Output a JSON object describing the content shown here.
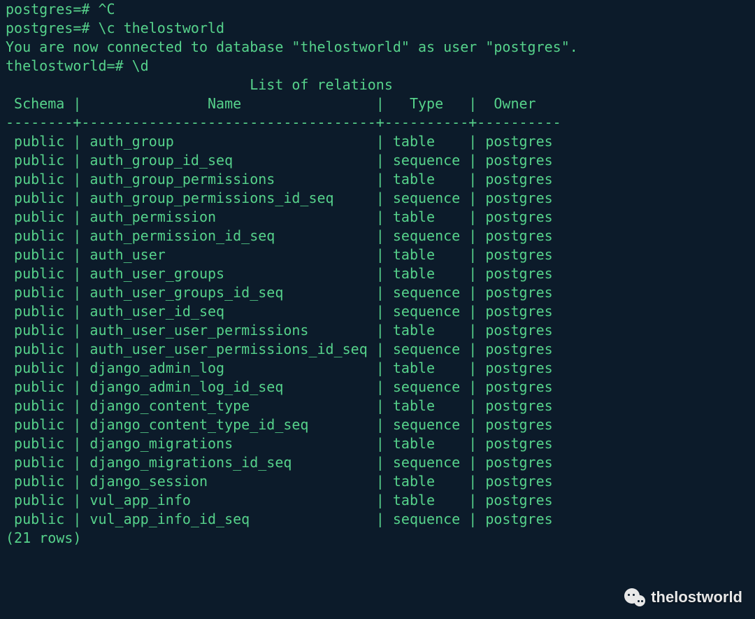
{
  "prompt0": "postgres=# ^C",
  "prompt1": "postgres=# \\c thelostworld",
  "connect_msg": "You are now connected to database \"thelostworld\" as user \"postgres\".",
  "prompt2": "thelostworld=# \\d",
  "title": "List of relations",
  "headers": {
    "schema": "Schema",
    "name": "Name",
    "type": "Type",
    "owner": "Owner"
  },
  "rows": [
    {
      "schema": "public",
      "name": "auth_group",
      "type": "table",
      "owner": "postgres"
    },
    {
      "schema": "public",
      "name": "auth_group_id_seq",
      "type": "sequence",
      "owner": "postgres"
    },
    {
      "schema": "public",
      "name": "auth_group_permissions",
      "type": "table",
      "owner": "postgres"
    },
    {
      "schema": "public",
      "name": "auth_group_permissions_id_seq",
      "type": "sequence",
      "owner": "postgres"
    },
    {
      "schema": "public",
      "name": "auth_permission",
      "type": "table",
      "owner": "postgres"
    },
    {
      "schema": "public",
      "name": "auth_permission_id_seq",
      "type": "sequence",
      "owner": "postgres"
    },
    {
      "schema": "public",
      "name": "auth_user",
      "type": "table",
      "owner": "postgres"
    },
    {
      "schema": "public",
      "name": "auth_user_groups",
      "type": "table",
      "owner": "postgres"
    },
    {
      "schema": "public",
      "name": "auth_user_groups_id_seq",
      "type": "sequence",
      "owner": "postgres"
    },
    {
      "schema": "public",
      "name": "auth_user_id_seq",
      "type": "sequence",
      "owner": "postgres"
    },
    {
      "schema": "public",
      "name": "auth_user_user_permissions",
      "type": "table",
      "owner": "postgres"
    },
    {
      "schema": "public",
      "name": "auth_user_user_permissions_id_seq",
      "type": "sequence",
      "owner": "postgres"
    },
    {
      "schema": "public",
      "name": "django_admin_log",
      "type": "table",
      "owner": "postgres"
    },
    {
      "schema": "public",
      "name": "django_admin_log_id_seq",
      "type": "sequence",
      "owner": "postgres"
    },
    {
      "schema": "public",
      "name": "django_content_type",
      "type": "table",
      "owner": "postgres"
    },
    {
      "schema": "public",
      "name": "django_content_type_id_seq",
      "type": "sequence",
      "owner": "postgres"
    },
    {
      "schema": "public",
      "name": "django_migrations",
      "type": "table",
      "owner": "postgres"
    },
    {
      "schema": "public",
      "name": "django_migrations_id_seq",
      "type": "sequence",
      "owner": "postgres"
    },
    {
      "schema": "public",
      "name": "django_session",
      "type": "table",
      "owner": "postgres"
    },
    {
      "schema": "public",
      "name": "vul_app_info",
      "type": "table",
      "owner": "postgres"
    },
    {
      "schema": "public",
      "name": "vul_app_info_id_seq",
      "type": "sequence",
      "owner": "postgres"
    }
  ],
  "row_count_label": "(21 rows)",
  "watermark": "thelostworld"
}
